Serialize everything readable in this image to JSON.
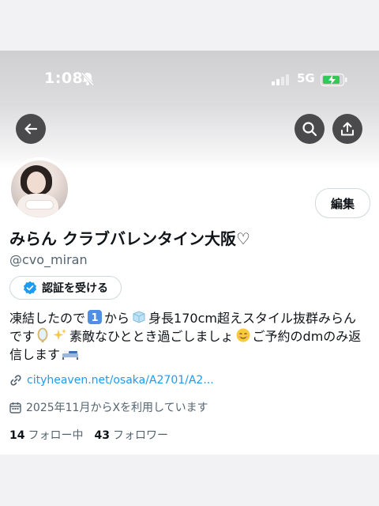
{
  "status_bar": {
    "time": "1:08",
    "network": "5G"
  },
  "icons": {
    "back": "arrow-left-icon",
    "search": "search-icon",
    "share": "share-icon",
    "bell_muted": "bell-slash-icon",
    "verified": "verified-badge-icon",
    "link": "link-icon",
    "calendar": "calendar-icon"
  },
  "profile": {
    "edit_label": "編集",
    "display_name": "みらん クラブバレンタイン大阪♡",
    "handle": "@cvo_miran",
    "verify_label": "認証を受ける",
    "bio": {
      "line1_a": "凍結したので",
      "line1_b": "から",
      "line1_c": "身長170cm超えスタイル抜群みらん",
      "line2_a": "です",
      "line2_b": "素敵なひととき過ごしましょ",
      "line2_c": "ご予約のdmのみ返",
      "line3_a": "信します"
    },
    "link_text": "cityheaven.net/osaka/A2701/A2...",
    "joined_text": "2025年11月からXを利用しています",
    "following_count": "14",
    "following_label": "フォロー中",
    "followers_count": "43",
    "followers_label": "フォロワー"
  },
  "colors": {
    "accent_blue": "#1d9bf0",
    "text_primary": "#0f1419",
    "text_secondary": "#536471",
    "battery_green": "#34c759"
  }
}
